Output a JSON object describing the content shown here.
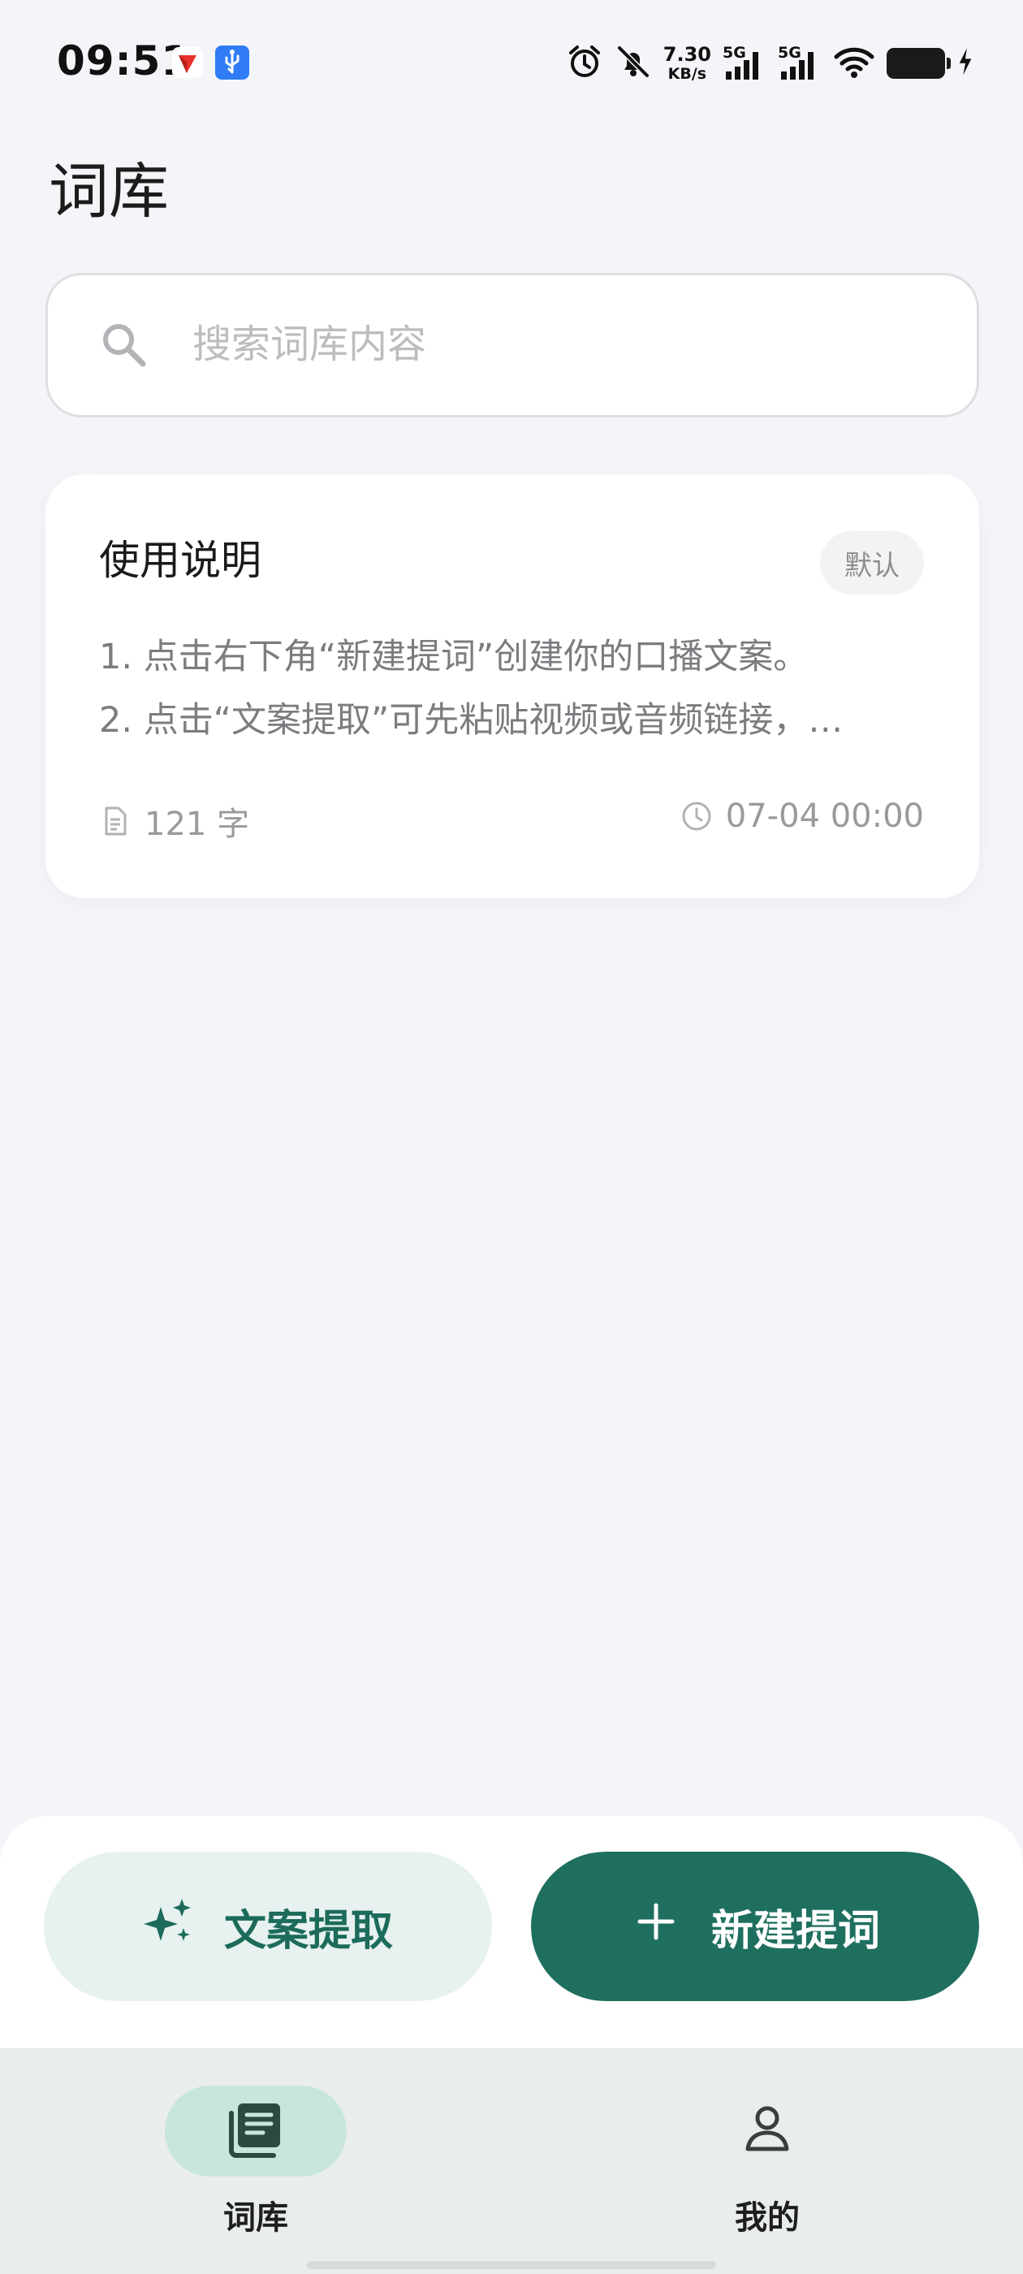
{
  "status_bar": {
    "time": "09:51",
    "net_speed_value": "7.30",
    "net_speed_unit": "KB/s",
    "sim1_label": "5G",
    "sim2_label": "5G",
    "icons": [
      "alarm-icon",
      "bell-off-icon",
      "signal-icon",
      "signal-icon",
      "wifi-icon",
      "battery-icon",
      "charging-icon"
    ]
  },
  "header": {
    "title": "词库"
  },
  "search": {
    "placeholder": "搜索词库内容",
    "value": ""
  },
  "documents": [
    {
      "title": "使用说明",
      "badge": "默认",
      "preview_line_1": "1. 点击右下角“新建提词”创建你的口播文案。",
      "preview_line_2": "2. 点击“文案提取”可先粘贴视频或音频链接，…",
      "word_count": "121 字",
      "timestamp": "07-04 00:00"
    }
  ],
  "actions": {
    "extract_label": "文案提取",
    "new_label": "新建提词"
  },
  "nav": {
    "items": [
      {
        "label": "词库",
        "icon": "library-icon",
        "active": true
      },
      {
        "label": "我的",
        "icon": "person-icon",
        "active": false
      }
    ]
  },
  "colors": {
    "accent": "#1f6f5f",
    "accent_light": "#e7f1ef",
    "nav_active_pill": "#c9e6dc",
    "background": "#f4f5f9"
  }
}
